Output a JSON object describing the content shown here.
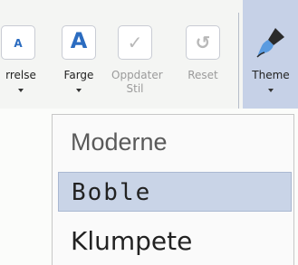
{
  "ribbon": {
    "buttons": [
      {
        "label": "rrelse",
        "icon": "font-size-icon",
        "glyph": "A"
      },
      {
        "label": "Farge",
        "icon": "font-colour-icon",
        "glyph": "A"
      },
      {
        "label": "Oppdater Stil",
        "icon": "checkmark-icon",
        "glyph": "✓"
      },
      {
        "label": "Reset",
        "icon": "undo-icon",
        "glyph": "↺"
      },
      {
        "label": "Theme",
        "icon": "paintbrush-icon"
      }
    ]
  },
  "theme_menu": {
    "items": [
      "Moderne",
      "Boble",
      "Klumpete"
    ],
    "selected": "Boble"
  },
  "colors": {
    "accent": "#2b6cc0",
    "selected_bg": "#c9d4e7",
    "theme_button_bg": "#c6d1e7"
  }
}
